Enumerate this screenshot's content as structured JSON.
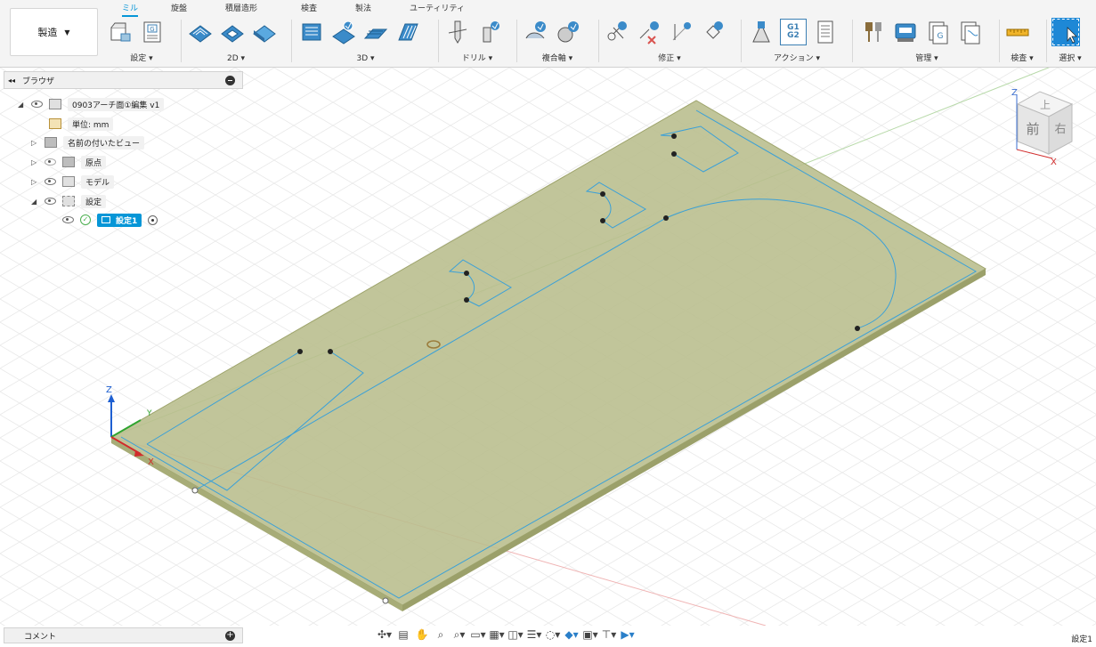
{
  "toolbar": {
    "workspace": "製造",
    "tabs": [
      "ミル",
      "旋盤",
      "積層造形",
      "検査",
      "製法",
      "ユーティリティ"
    ],
    "active_tab": "ミル",
    "groups": [
      {
        "label": "設定 ▾"
      },
      {
        "label": "2D ▾"
      },
      {
        "label": "3D ▾"
      },
      {
        "label": "ドリル ▾"
      },
      {
        "label": "複合軸 ▾"
      },
      {
        "label": "修正 ▾"
      },
      {
        "label": "アクション ▾"
      },
      {
        "label": "管理 ▾"
      },
      {
        "label": "検査 ▾"
      },
      {
        "label": "選択 ▾"
      }
    ],
    "g1g2_label": "G1 G2",
    "accent_color": "#0696d7"
  },
  "browser": {
    "title": "ブラウザ",
    "items": [
      {
        "label": "0903アーチ面①編集 v1"
      },
      {
        "label": "単位: mm"
      },
      {
        "label": "名前の付いたビュー"
      },
      {
        "label": "原点"
      },
      {
        "label": "モデル"
      },
      {
        "label": "設定"
      },
      {
        "label": "設定1"
      }
    ]
  },
  "viewcube": {
    "top": "上",
    "front": "前",
    "right": "右",
    "z_axis": "Z",
    "x_axis": "X"
  },
  "triad": {
    "z": "Z",
    "y": "Y",
    "x": "X"
  },
  "stock": {
    "fill_color": "#b8bd8c",
    "outline_color": "#3aa0d8"
  },
  "comment_bar": {
    "label": "コメント"
  },
  "navigation": {
    "icons": [
      "orbit-icon",
      "look-at-icon",
      "pan-icon",
      "zoom-icon",
      "fit-icon",
      "display-icon",
      "grid-icon",
      "viewports-icon",
      "section-icon",
      "orbit-type-icon",
      "visual-style-icon",
      "environment-icon",
      "effects-icon",
      "camera-icon"
    ]
  },
  "status": {
    "setup": "設定1"
  }
}
